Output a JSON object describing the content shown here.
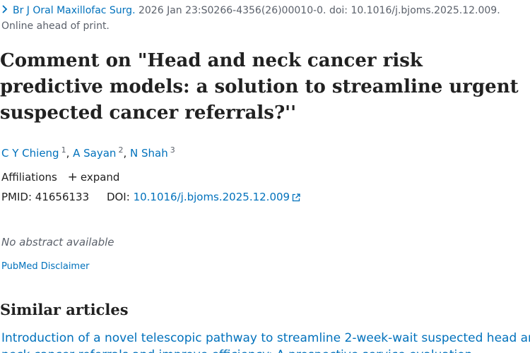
{
  "citation": {
    "journal": "Br J Oral Maxillofac Surg.",
    "details": "2026 Jan 23:S0266-4356(26)00010-0. doi: 10.1016/j.bjoms.2025.12.009.",
    "status": "Online ahead of print."
  },
  "article": {
    "title": "Comment on \"Head and neck cancer risk predictive models: a solution to streamline urgent suspected cancer referrals?''"
  },
  "authors": [
    {
      "name": "C Y Chieng",
      "aff": "1"
    },
    {
      "name": "A Sayan",
      "aff": "2"
    },
    {
      "name": "N Shah",
      "aff": "3"
    }
  ],
  "affiliations": {
    "label": "Affiliations",
    "expand_label": "expand"
  },
  "identifiers": {
    "pmid_label": "PMID:",
    "pmid": "41656133",
    "doi_label": "DOI:",
    "doi": "10.1016/j.bjoms.2025.12.009"
  },
  "abstract": {
    "text": "No abstract available"
  },
  "disclaimer": {
    "label": "PubMed Disclaimer"
  },
  "similar": {
    "heading": "Similar articles",
    "items": [
      {
        "line1": "Introduction of a novel telescopic pathway to streamline 2-week-wait suspected head and",
        "line2": "neck cancer referrals and improve efficiency: A prospective service evaluation."
      }
    ]
  },
  "colors": {
    "link": "#0071bc",
    "text": "#212121",
    "muted": "#5b616b"
  }
}
